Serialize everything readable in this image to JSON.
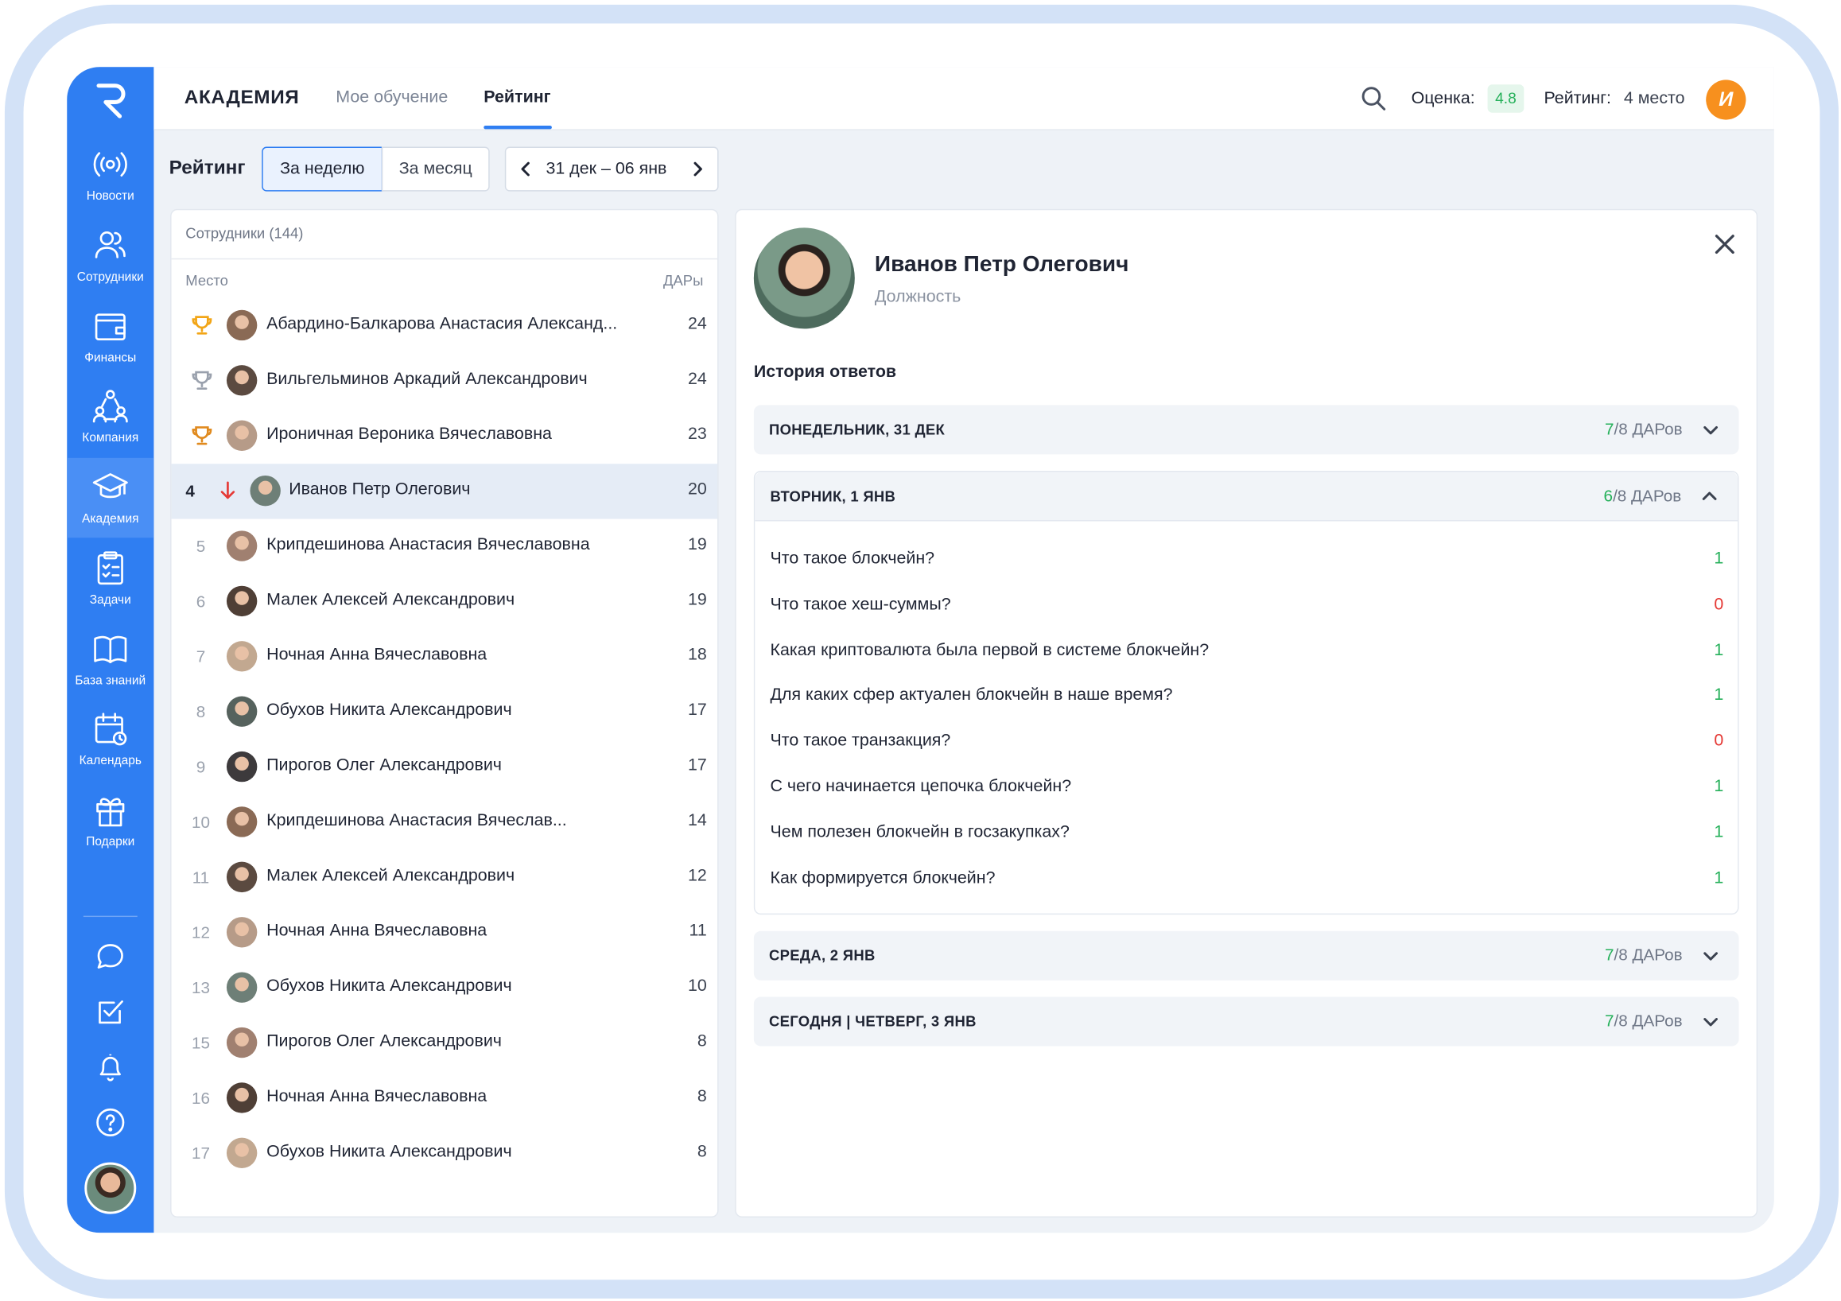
{
  "sidebar": {
    "logo": "R",
    "items": [
      {
        "label": "Новости",
        "icon": "broadcast-icon"
      },
      {
        "label": "Сотрудники",
        "icon": "users-icon"
      },
      {
        "label": "Финансы",
        "icon": "wallet-icon"
      },
      {
        "label": "Компания",
        "icon": "company-icon"
      },
      {
        "label": "Академия",
        "icon": "graduation-cap-icon",
        "active": true
      },
      {
        "label": "Задачи",
        "icon": "clipboard-icon"
      },
      {
        "label": "База знаний",
        "icon": "book-icon"
      },
      {
        "label": "Календарь",
        "icon": "calendar-icon"
      },
      {
        "label": "Подарки",
        "icon": "gift-icon"
      }
    ],
    "bottom_icons": [
      "chat-icon",
      "checkbox-icon",
      "bell-icon",
      "help-icon"
    ]
  },
  "header": {
    "title": "АКАДЕМИЯ",
    "tabs": [
      {
        "label": "Мое обучение",
        "active": false
      },
      {
        "label": "Рейтинг",
        "active": true
      }
    ],
    "score_label": "Оценка:",
    "score_value": "4.8",
    "rank_label": "Рейтинг:",
    "rank_value": "4 место",
    "user_initial": "И"
  },
  "filters": {
    "title": "Рейтинг",
    "period_week": "За неделю",
    "period_month": "За месяц",
    "selected_period": "За неделю",
    "date_range": "31 дек – 06 янв"
  },
  "list": {
    "header": "Сотрудники (144)",
    "col_place": "Место",
    "col_points": "ДАРы",
    "rows": [
      {
        "place": "",
        "trophy": "gold",
        "name": "Абардино-Балкарова Анастасия Александ...",
        "points": "24"
      },
      {
        "place": "",
        "trophy": "silver",
        "name": "Вильгельминов Аркадий Александрович",
        "points": "24"
      },
      {
        "place": "",
        "trophy": "bronze",
        "name": "Ироничная Вероника Вячеславовна",
        "points": "23"
      },
      {
        "place": "4",
        "trophy": "",
        "name": "Иванов Петр Олегович",
        "points": "20",
        "selected": true,
        "trend": "down"
      },
      {
        "place": "5",
        "trophy": "",
        "name": "Крипдешинова Анастасия Вячеславовна",
        "points": "19"
      },
      {
        "place": "6",
        "trophy": "",
        "name": "Малек Алексей Александрович",
        "points": "19"
      },
      {
        "place": "7",
        "trophy": "",
        "name": "Ночная Анна Вячеславовна",
        "points": "18"
      },
      {
        "place": "8",
        "trophy": "",
        "name": "Обухов Никита Александрович",
        "points": "17"
      },
      {
        "place": "9",
        "trophy": "",
        "name": "Пирогов Олег Александрович",
        "points": "17"
      },
      {
        "place": "10",
        "trophy": "",
        "name": "Крипдешинова Анастасия Вячеслав...",
        "points": "14"
      },
      {
        "place": "11",
        "trophy": "",
        "name": "Малек Алексей Александрович",
        "points": "12"
      },
      {
        "place": "12",
        "trophy": "",
        "name": "Ночная Анна Вячеславовна",
        "points": "11"
      },
      {
        "place": "13",
        "trophy": "",
        "name": "Обухов Никита Александрович",
        "points": "10"
      },
      {
        "place": "15",
        "trophy": "",
        "name": "Пирогов Олег Александрович",
        "points": "8"
      },
      {
        "place": "16",
        "trophy": "",
        "name": "Ночная Анна Вячеславовна",
        "points": "8"
      },
      {
        "place": "17",
        "trophy": "",
        "name": "Обухов Никита Александрович",
        "points": "8"
      }
    ]
  },
  "detail": {
    "name": "Иванов Петр Олегович",
    "role": "Должность",
    "history_title": "История ответов",
    "days": [
      {
        "title": "ПОНЕДЕЛЬНИК, 31 ДЕК",
        "correct": "7",
        "total": "/8 ДАРов",
        "expanded": false
      },
      {
        "title": "ВТОРНИК, 1 ЯНВ",
        "correct": "6",
        "total": "/8 ДАРов",
        "expanded": true,
        "questions": [
          {
            "q": "Что такое блокчейн?",
            "v": "1"
          },
          {
            "q": "Что такое хеш-суммы?",
            "v": "0"
          },
          {
            "q": "Какая криптовалюта была первой в системе блокчейн?",
            "v": "1"
          },
          {
            "q": "Для каких сфер актуален блокчейн в наше время?",
            "v": "1"
          },
          {
            "q": "Что такое транзакция?",
            "v": "0"
          },
          {
            "q": "С чего начинается цепочка блокчейн?",
            "v": "1"
          },
          {
            "q": "Чем полезен блокчейн в госзакупках?",
            "v": "1"
          },
          {
            "q": "Как формируется блокчейн?",
            "v": "1"
          }
        ]
      },
      {
        "title": "СРЕДА, 2 ЯНВ",
        "correct": "7",
        "total": "/8 ДАРов",
        "expanded": false
      },
      {
        "title": "СЕГОДНЯ | ЧЕТВЕРГ, 3 ЯНВ",
        "correct": "7",
        "total": "/8 ДАРов",
        "expanded": false
      }
    ]
  },
  "colors": {
    "accent": "#2f7ef2",
    "positive": "#25b05a",
    "negative": "#e53935",
    "badge": "#f7901e",
    "gold": "#f2a516",
    "silver": "#9aa1ad",
    "bronze": "#e08a1e"
  }
}
